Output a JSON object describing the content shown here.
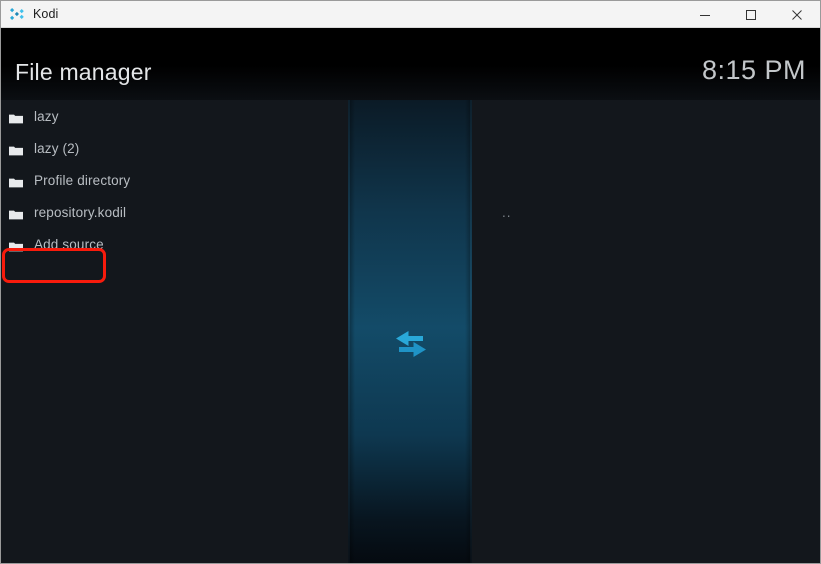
{
  "titlebar": {
    "app_name": "Kodi",
    "app_icon": "kodi-logo-icon",
    "minimize_label": "—",
    "maximize_label": "□",
    "close_label": "✕"
  },
  "header": {
    "page_title": "File manager",
    "clock": "8:15 PM"
  },
  "left_pane": {
    "items": [
      {
        "label": "lazy",
        "icon": "folder-icon"
      },
      {
        "label": "lazy (2)",
        "icon": "folder-icon"
      },
      {
        "label": "Profile directory",
        "icon": "folder-icon"
      },
      {
        "label": "repository.kodil",
        "icon": "folder-icon"
      },
      {
        "label": "Add source",
        "icon": "folder-icon"
      }
    ],
    "highlighted_item": "Add source"
  },
  "right_pane": {
    "items": [
      {
        "label": ".."
      }
    ]
  },
  "center": {
    "swap_icon": "swap-arrows-icon"
  },
  "colors": {
    "accent_teal": "#134b68",
    "arrow_cyan": "#29a8d8",
    "annotation_red": "#f81b0c",
    "background": "#13171c",
    "text_primary": "#b9bec3",
    "title_text": "#e4e6e8"
  }
}
